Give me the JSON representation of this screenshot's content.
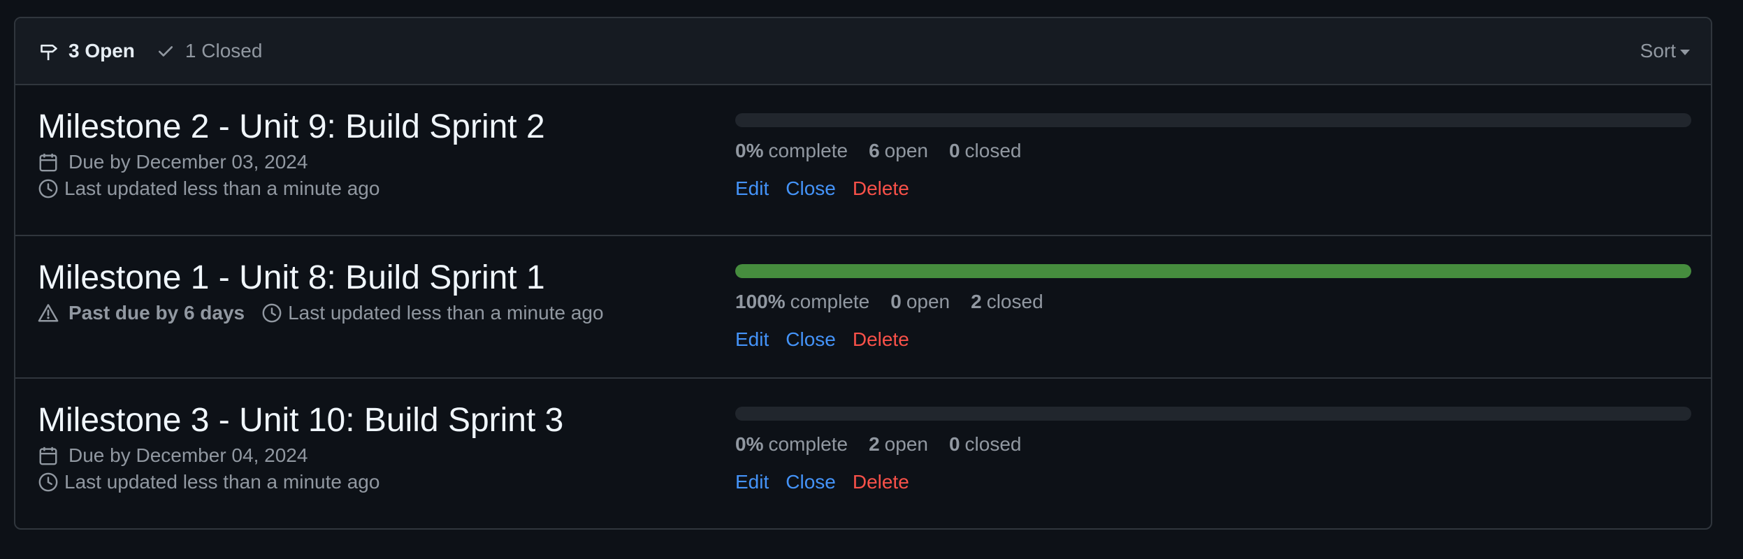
{
  "header": {
    "open_label": "3 Open",
    "closed_label": "1 Closed",
    "sort_label": "Sort"
  },
  "milestones": [
    {
      "title": "Milestone 2 - Unit 9: Build Sprint 2",
      "due": "Due by December 03, 2024",
      "updated": "Last updated less than a minute ago",
      "progress": 0,
      "percent": "0%",
      "complete_label": "complete",
      "open_count": "6",
      "open_label": "open",
      "closed_count": "0",
      "closed_label": "closed",
      "edit": "Edit",
      "close": "Close",
      "delete": "Delete"
    },
    {
      "title": "Milestone 1 - Unit 8: Build Sprint 1",
      "past_due": "Past due by 6 days",
      "updated": "Last updated less than a minute ago",
      "progress": 1,
      "percent": "100%",
      "complete_label": "complete",
      "open_count": "0",
      "open_label": "open",
      "closed_count": "2",
      "closed_label": "closed",
      "edit": "Edit",
      "close": "Close",
      "delete": "Delete"
    },
    {
      "title": "Milestone 3 - Unit 10: Build Sprint 3",
      "due": "Due by December 04, 2024",
      "updated": "Last updated less than a minute ago",
      "progress": 0,
      "percent": "0%",
      "complete_label": "complete",
      "open_count": "2",
      "open_label": "open",
      "closed_count": "0",
      "closed_label": "closed",
      "edit": "Edit",
      "close": "Close",
      "delete": "Delete"
    }
  ],
  "colors": {
    "progress_fill": "#468d3e",
    "link": "#4493f8",
    "danger": "#f85149"
  },
  "icons": [
    "milestone-icon",
    "check-icon",
    "calendar-icon",
    "clock-icon",
    "alert-icon"
  ]
}
